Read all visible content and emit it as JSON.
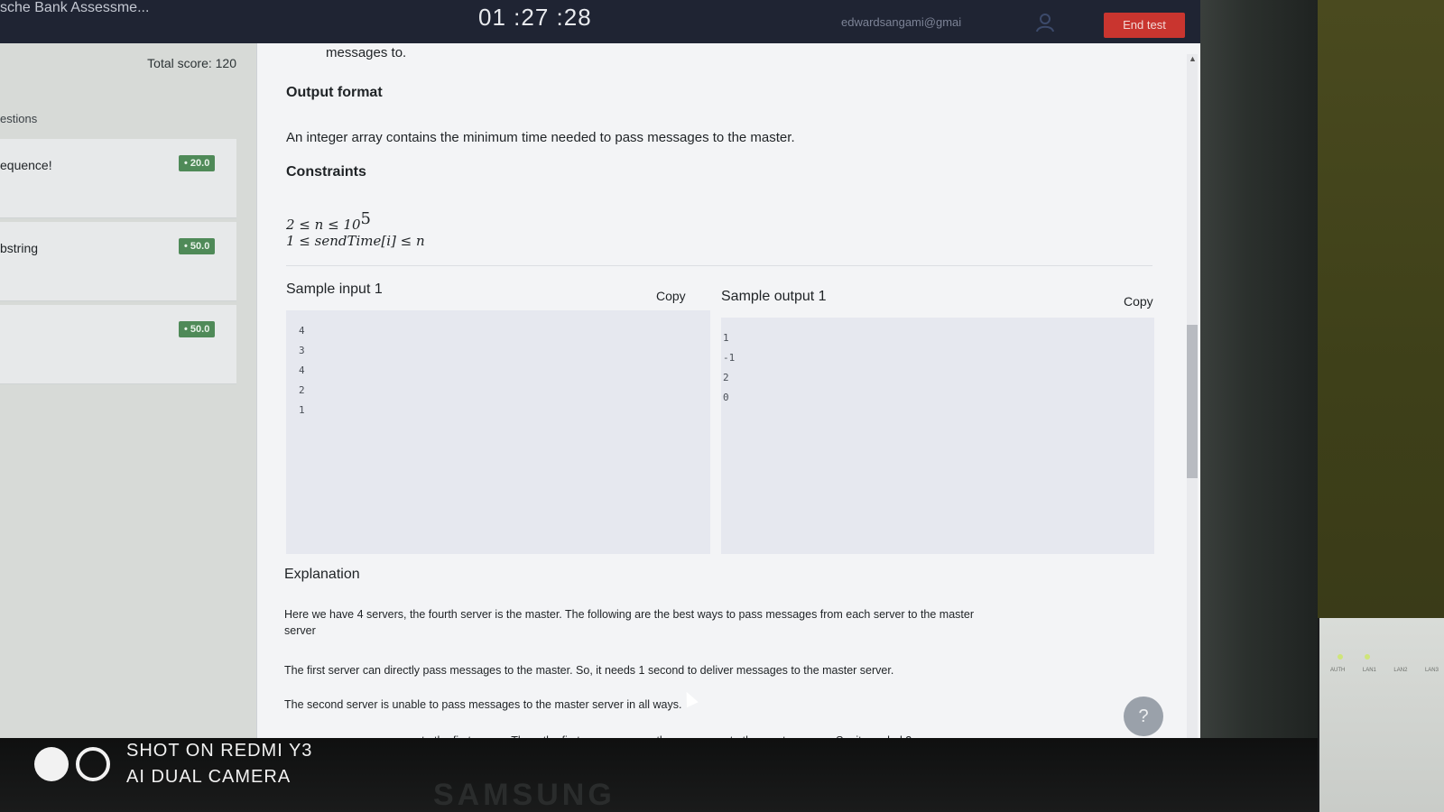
{
  "header": {
    "app_title": "sche Bank Assessme...",
    "timer": "01 :27 :28",
    "email": "edwardsangami@gmai",
    "end_test_label": "End test"
  },
  "sidebar": {
    "total_score": "Total score: 120",
    "section_label": "estions",
    "questions": [
      {
        "name": "equence!",
        "score": "• 20.0"
      },
      {
        "name": "bstring",
        "score": "• 50.0"
      },
      {
        "name": "",
        "score": "• 50.0"
      }
    ]
  },
  "problem": {
    "intro_tail": "messages to.",
    "output_format_heading": "Output format",
    "output_format_text": "An integer array contains the minimum time needed to pass messages to the master.",
    "constraints_heading": "Constraints",
    "constraint_1": "2 ≤ n ≤ 10",
    "constraint_1_exp": "5",
    "constraint_2": "1 ≤ sendTime[i] ≤ n",
    "sample_input_heading": "Sample input 1",
    "sample_output_heading": "Sample output 1",
    "copy_label": "Copy",
    "sample_input_lines": [
      "4",
      "3",
      "4",
      "2",
      "1"
    ],
    "sample_output_lines": [
      "1",
      "-1",
      "2",
      "0"
    ],
    "explanation_heading": "Explanation",
    "explanation_lines": [
      "Here we have 4 servers, the fourth server is the master. The following are the best ways to pass messages from each server to the master",
      "server",
      "The first server can directly pass messages to the master. So, it needs 1 second to deliver messages to the master server.",
      "The second server is unable to pass messages to the master server in all ways.",
      "server can pass messages to the first server. Then, the first server passes the messages to the master server. So, it needed 2"
    ],
    "help_icon": "?"
  },
  "watermark": {
    "line1": "SHOT ON REDMI Y3",
    "line2": "AI DUAL CAMERA"
  },
  "monitor": {
    "brand": "SAMSUNG",
    "port_labels": [
      "AUTH",
      "LAN1",
      "LAN2",
      "LAN3"
    ]
  },
  "colors": {
    "topbar": "#1f2433",
    "end_button": "#c9352f",
    "score_badge": "#4f8a58",
    "copy_link": "#6d8fc4"
  }
}
